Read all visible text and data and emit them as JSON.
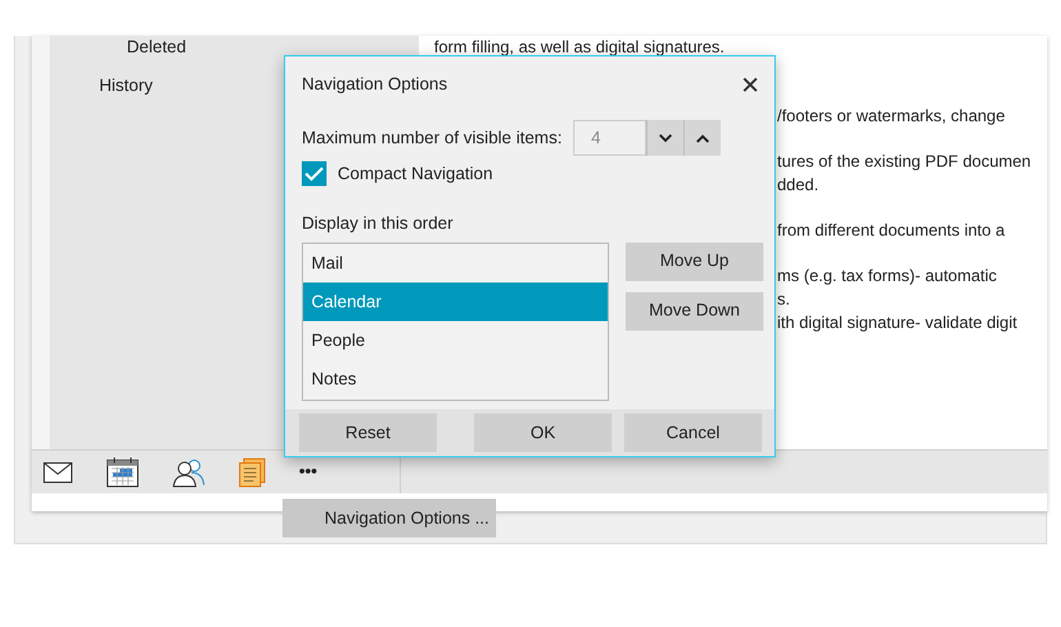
{
  "sidebar": {
    "items": [
      {
        "label": "Deleted",
        "kind": "subfolder"
      },
      {
        "label": "History",
        "kind": "folder"
      }
    ]
  },
  "nav_bar": {
    "more": "•••"
  },
  "content": {
    "paragraphs": [
      {
        "kind": "full",
        "lines": [
          "form filling, as well as digital signatures."
        ]
      },
      {
        "kind": "partial",
        "lines": [
          "/footers or watermarks, change"
        ]
      },
      {
        "kind": "partial",
        "lines": [
          "tures of the existing PDF documen",
          "dded."
        ]
      },
      {
        "kind": "partial",
        "lines": [
          "from different documents into a"
        ]
      },
      {
        "kind": "partial",
        "lines": [
          "ms (e.g. tax forms)- automatic",
          "s.",
          "ith digital signature- validate digit"
        ]
      }
    ]
  },
  "dialog": {
    "title": "Navigation Options",
    "max_items": {
      "label": "Maximum number of visible items:",
      "value": "4"
    },
    "compact": {
      "label": "Compact Navigation",
      "checked": true
    },
    "order_label": "Display in this order",
    "order_items": [
      {
        "label": "Mail",
        "selected": false
      },
      {
        "label": "Calendar",
        "selected": true
      },
      {
        "label": "People",
        "selected": false
      },
      {
        "label": "Notes",
        "selected": false
      }
    ],
    "side_buttons": [
      "Move Up",
      "Move Down"
    ],
    "footer_buttons": [
      "Reset",
      "OK",
      "Cancel"
    ]
  },
  "popup": {
    "label": "Navigation Options ..."
  }
}
